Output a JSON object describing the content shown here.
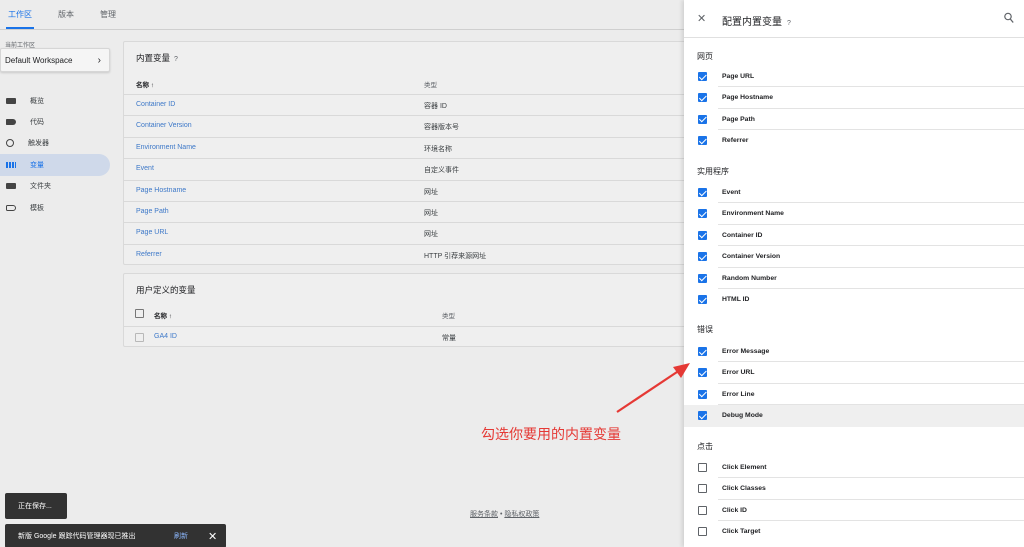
{
  "nav": {
    "tabs": [
      "工作区",
      "版本",
      "管理"
    ]
  },
  "workspace": {
    "label": "当前工作区",
    "name": "Default Workspace"
  },
  "sidebar": {
    "items": [
      {
        "label": "概览",
        "icon": "overview-icon"
      },
      {
        "label": "代码",
        "icon": "tag-icon"
      },
      {
        "label": "触发器",
        "icon": "trigger-icon"
      },
      {
        "label": "变量",
        "icon": "variables-icon"
      },
      {
        "label": "文件夹",
        "icon": "folder-icon"
      },
      {
        "label": "模板",
        "icon": "template-icon"
      }
    ]
  },
  "builtin_card": {
    "title": "内置变量",
    "help": "?",
    "col_name": "名称 ↑",
    "col_type": "类型",
    "rows": [
      {
        "name": "Container ID",
        "type": "容器 ID"
      },
      {
        "name": "Container Version",
        "type": "容器版本号"
      },
      {
        "name": "Environment Name",
        "type": "环境名称"
      },
      {
        "name": "Event",
        "type": "自定义事件"
      },
      {
        "name": "Page Hostname",
        "type": "网址"
      },
      {
        "name": "Page Path",
        "type": "网址"
      },
      {
        "name": "Page URL",
        "type": "网址"
      },
      {
        "name": "Referrer",
        "type": "HTTP 引荐来源网址"
      }
    ]
  },
  "user_card": {
    "title": "用户定义的变量",
    "col_name": "名称 ↑",
    "col_type": "类型",
    "rows": [
      {
        "name": "GA4 ID",
        "type": "常量"
      }
    ]
  },
  "footer": {
    "terms": "服务条款",
    "sep": "•",
    "privacy": "隐私权政策"
  },
  "toasts": {
    "saving": "正在保存...",
    "notice": "新版 Google 跟踪代码管理器现已推出",
    "refresh": "刷新",
    "close": "✕"
  },
  "panel": {
    "close": "✕",
    "title": "配置内置变量",
    "help": "?",
    "sections": [
      {
        "title": "网页",
        "items": [
          {
            "label": "Page URL",
            "checked": true
          },
          {
            "label": "Page Hostname",
            "checked": true
          },
          {
            "label": "Page Path",
            "checked": true
          },
          {
            "label": "Referrer",
            "checked": true
          }
        ]
      },
      {
        "title": "实用程序",
        "items": [
          {
            "label": "Event",
            "checked": true
          },
          {
            "label": "Environment Name",
            "checked": true
          },
          {
            "label": "Container ID",
            "checked": true
          },
          {
            "label": "Container Version",
            "checked": true
          },
          {
            "label": "Random Number",
            "checked": true
          },
          {
            "label": "HTML ID",
            "checked": true
          }
        ]
      },
      {
        "title": "错误",
        "items": [
          {
            "label": "Error Message",
            "checked": true
          },
          {
            "label": "Error URL",
            "checked": true
          },
          {
            "label": "Error Line",
            "checked": true
          },
          {
            "label": "Debug Mode",
            "checked": true
          }
        ]
      },
      {
        "title": "点击",
        "items": [
          {
            "label": "Click Element",
            "checked": false
          },
          {
            "label": "Click Classes",
            "checked": false
          },
          {
            "label": "Click ID",
            "checked": false
          },
          {
            "label": "Click Target",
            "checked": false
          }
        ]
      }
    ]
  },
  "annotation": {
    "text": "勾选你要用的内置变量",
    "color": "#e53935"
  }
}
